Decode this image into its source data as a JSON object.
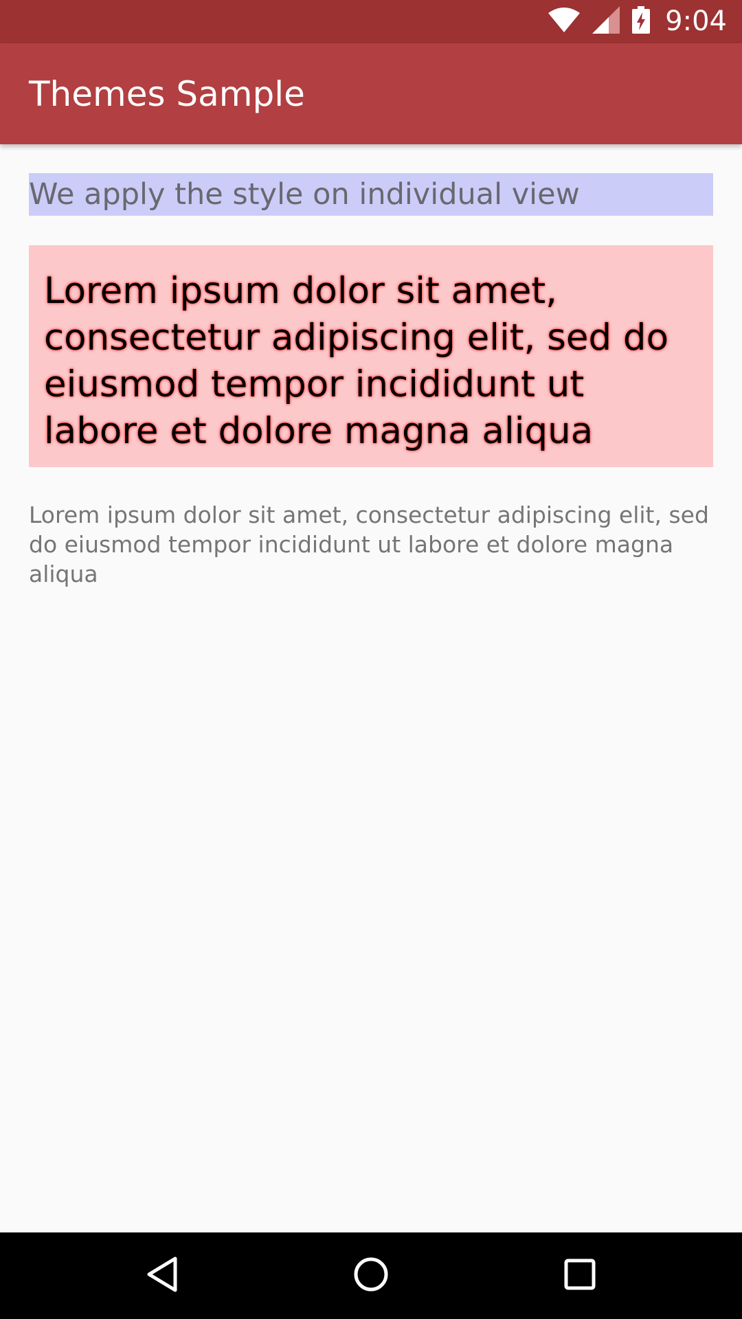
{
  "status_bar": {
    "time": "9:04",
    "icons": [
      "wifi-icon",
      "cellular-signal-icon",
      "battery-charging-icon"
    ],
    "background": "#9c3232"
  },
  "app_bar": {
    "title": "Themes Sample",
    "background": "#b23f41"
  },
  "main": {
    "styled_label": "We apply the style on individual view",
    "styled_label_background": "#ccccf9",
    "lorem_styled": "Lorem ipsum dolor sit amet, consectetur adipiscing elit, sed do eiusmod tempor incididunt ut labore et dolore magna aliqua",
    "lorem_styled_background": "#fcc8ca",
    "lorem_plain": "Lorem ipsum dolor sit amet, consectetur adipiscing elit, sed do eiusmod tempor incididunt ut labore et dolore magna aliqua"
  },
  "nav_bar": {
    "buttons": [
      "back-icon",
      "home-icon",
      "recents-icon"
    ]
  }
}
